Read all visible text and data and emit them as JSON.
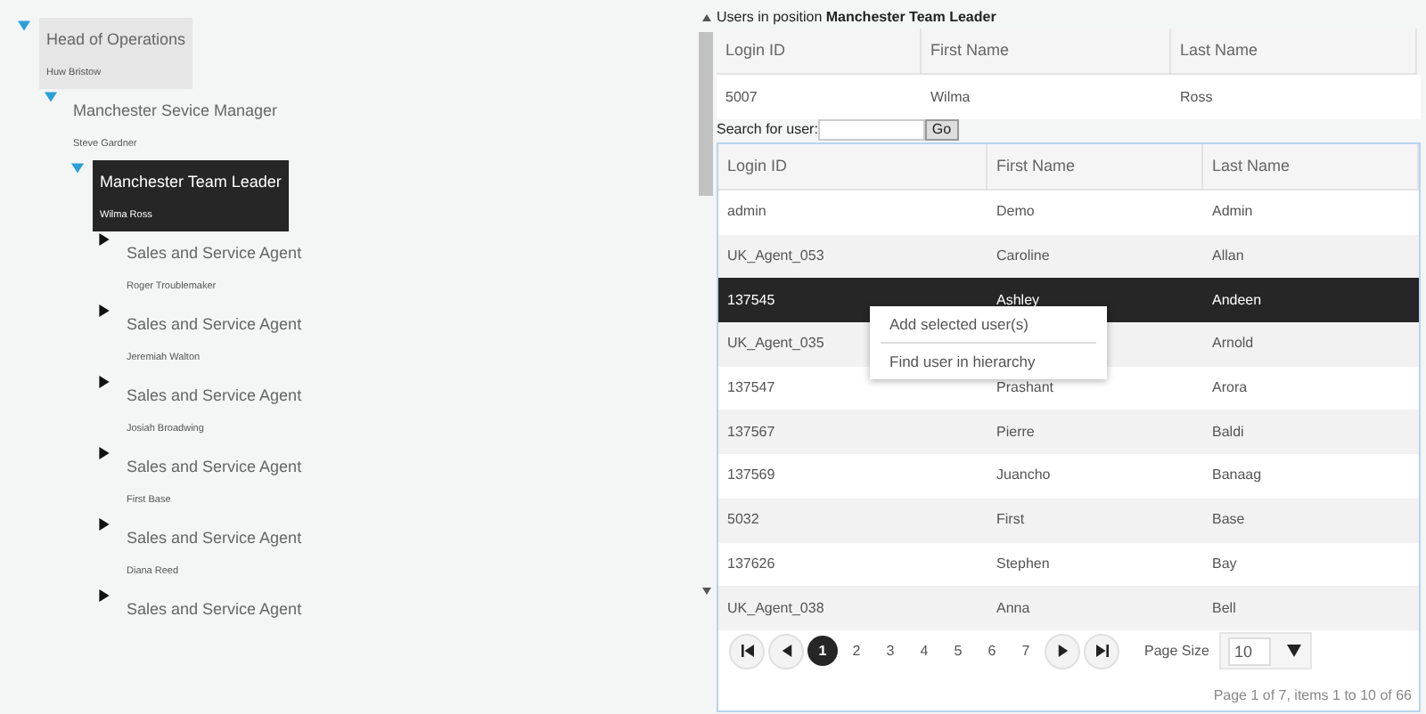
{
  "tree": [
    {
      "title": "Head of Operations",
      "person": "Huw Bristow",
      "expanded": true,
      "selected": false,
      "hovered": true,
      "children": [
        {
          "title": "Manchester Sevice Manager",
          "person": "Steve Gardner",
          "expanded": true,
          "selected": false,
          "hovered": false,
          "children": [
            {
              "title": "Manchester Team Leader",
              "person": "Wilma Ross",
              "expanded": true,
              "selected": true,
              "hovered": false,
              "children": [
                {
                  "title": "Sales and Service Agent",
                  "person": "Roger Troublemaker",
                  "expanded": false,
                  "selected": false,
                  "hovered": false
                },
                {
                  "title": "Sales and Service Agent",
                  "person": "Jeremiah Walton",
                  "expanded": false,
                  "selected": false,
                  "hovered": false
                },
                {
                  "title": "Sales and Service Agent",
                  "person": "Josiah Broadwing",
                  "expanded": false,
                  "selected": false,
                  "hovered": false
                },
                {
                  "title": "Sales and Service Agent",
                  "person": "First Base",
                  "expanded": false,
                  "selected": false,
                  "hovered": false
                },
                {
                  "title": "Sales and Service Agent",
                  "person": "Diana Reed",
                  "expanded": false,
                  "selected": false,
                  "hovered": false
                },
                {
                  "title": "Sales and Service Agent",
                  "expanded": false,
                  "selected": false,
                  "hovered": false
                }
              ]
            }
          ]
        }
      ]
    }
  ],
  "position_users": {
    "caption": "Users in position **Manchester Team Leader**",
    "columns": [
      "Login ID",
      "First Name",
      "Last Name"
    ],
    "rows": [
      {
        "login_id": "5007",
        "first_name": "Wilma",
        "last_name": "Ross"
      }
    ]
  },
  "search": {
    "label": "Search for user:",
    "button": "Go"
  },
  "users_grid": {
    "columns": [
      "Login ID",
      "First Name",
      "Last Name"
    ],
    "rows": [
      {
        "login_id": "admin",
        "first_name": "Demo",
        "last_name": "Admin",
        "selected": false
      },
      {
        "login_id": "UK_Agent_053",
        "first_name": "Caroline",
        "last_name": "Allan",
        "selected": false
      },
      {
        "login_id": "137545",
        "first_name": "Ashley",
        "last_name": "Andeen",
        "selected": true
      },
      {
        "login_id": "UK_Agent_035",
        "last_name": "Arnold",
        "selected": false
      },
      {
        "login_id": "137547",
        "first_name": "Prashant",
        "last_name": "Arora",
        "selected": false
      },
      {
        "login_id": "137567",
        "first_name": "Pierre",
        "last_name": "Baldi",
        "selected": false
      },
      {
        "login_id": "137569",
        "first_name": "Juancho",
        "last_name": "Banaag",
        "selected": false
      },
      {
        "login_id": "5032",
        "first_name": "First",
        "last_name": "Base",
        "selected": false
      },
      {
        "login_id": "137626",
        "first_name": "Stephen",
        "last_name": "Bay",
        "selected": false
      },
      {
        "login_id": "UK_Agent_038",
        "first_name": "Anna",
        "last_name": "Bell",
        "selected": false
      }
    ],
    "pager": {
      "pages": [
        {
          "label": "1",
          "selected": true
        },
        {
          "label": "2",
          "selected": false
        },
        {
          "label": "3",
          "selected": false
        },
        {
          "label": "4",
          "selected": false
        },
        {
          "label": "5",
          "selected": false
        },
        {
          "label": "6",
          "selected": false
        },
        {
          "label": "7",
          "selected": false
        }
      ],
      "page_size_label": "Page Size",
      "page_size": "10",
      "info": "Page 1 of 7, items 1 to 10 of 66"
    }
  },
  "context_menu": {
    "items": [
      "Add selected user(s)",
      "Find user in hierarchy"
    ]
  }
}
